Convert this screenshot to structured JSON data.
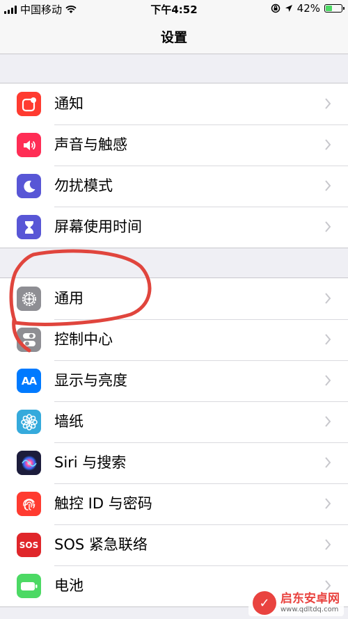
{
  "status_bar": {
    "carrier": "中国移动",
    "time": "下午4:52",
    "battery_percent": "42%",
    "battery_level": 0.42,
    "icons": [
      "signal-icon",
      "wifi-icon",
      "rotation-lock-icon",
      "location-icon",
      "battery-icon"
    ]
  },
  "nav": {
    "title": "设置"
  },
  "groups": [
    {
      "items": [
        {
          "label": "通知",
          "icon": "notifications-icon",
          "color": "#ff3b30"
        },
        {
          "label": "声音与触感",
          "icon": "sound-icon",
          "color": "#ff2d55"
        },
        {
          "label": "勿扰模式",
          "icon": "moon-icon",
          "color": "#5856d6"
        },
        {
          "label": "屏幕使用时间",
          "icon": "hourglass-icon",
          "color": "#5856d6"
        }
      ]
    },
    {
      "items": [
        {
          "label": "通用",
          "icon": "gear-icon",
          "color": "#8e8e93"
        },
        {
          "label": "控制中心",
          "icon": "toggles-icon",
          "color": "#8e8e93"
        },
        {
          "label": "显示与亮度",
          "icon": "display-icon",
          "color": "#007aff",
          "glyph": "AA"
        },
        {
          "label": "墙纸",
          "icon": "flower-icon",
          "color": "#35aadc"
        },
        {
          "label": "Siri 与搜索",
          "icon": "siri-icon",
          "color": "#1c1c3c"
        },
        {
          "label": "触控 ID 与密码",
          "icon": "fingerprint-icon",
          "color": "#ff3b30"
        },
        {
          "label": "SOS 紧急联络",
          "icon": "sos-icon",
          "color": "#e0262a",
          "glyph": "SOS"
        },
        {
          "label": "电池",
          "icon": "battery-setting-icon",
          "color": "#4cd964"
        }
      ]
    }
  ],
  "annotation": {
    "color": "#e0453d"
  },
  "watermark": {
    "title": "启东安卓网",
    "url": "www.qdltdq.com"
  }
}
